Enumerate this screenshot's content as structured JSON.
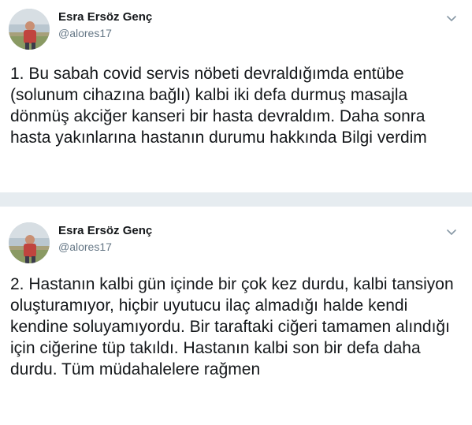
{
  "tweets": [
    {
      "author_name": "Esra Ersöz Genç",
      "handle": "@alores17",
      "text": "1. Bu sabah covid servis nöbeti devraldığımda entübe (solunum cihazına bağlı) kalbi iki defa durmuş masajla dönmüş akciğer kanseri bir hasta devraldım. Daha sonra hasta yakınlarına hastanın durumu hakkında Bilgi verdim"
    },
    {
      "author_name": "Esra Ersöz Genç",
      "handle": "@alores17",
      "text": "2. Hastanın kalbi gün içinde bir çok kez durdu, kalbi tansiyon oluşturamıyor, hiçbir uyutucu ilaç almadığı halde kendi kendine soluyamıyordu. Bir taraftaki ciğeri tamamen alındığı için ciğerine tüp takıldı. Hastanın kalbi son bir defa daha durdu. Tüm müdahalelere rağmen"
    }
  ],
  "icons": {
    "more": "chevron-down-icon",
    "avatar": "avatar"
  },
  "colors": {
    "primary_text": "#14171a",
    "secondary_text": "#657786",
    "divider": "#e6ecf0"
  }
}
